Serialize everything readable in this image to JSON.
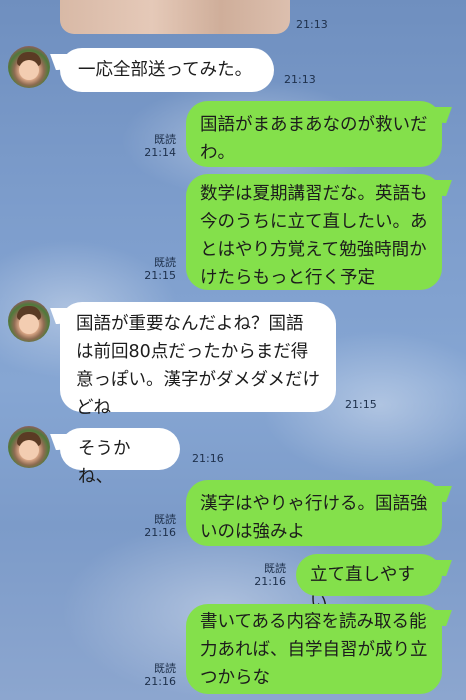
{
  "colors": {
    "background": "#7c9bc9",
    "sent_bubble": "#84e04b",
    "received_bubble": "#ffffff",
    "meta_text": "#1d2f4a"
  },
  "top_photo": {
    "time": "21:13"
  },
  "messages": [
    {
      "side": "left",
      "text": "一応全部送ってみた。",
      "time": "21:13"
    },
    {
      "side": "right",
      "text": "国語がまあまあなのが救いだわ。",
      "read": "既読",
      "time": "21:14"
    },
    {
      "side": "right",
      "text": "数学は夏期講習だな。英語も今のうちに立て直したい。あとはやり方覚えて勉強時間かけたらもっと行く予定",
      "read": "既読",
      "time": "21:15"
    },
    {
      "side": "left",
      "text": "国語が重要なんだよね？国語は前回80点だったからまだ得意っぽい。漢字がダメダメだけどね",
      "time": "21:15"
    },
    {
      "side": "left",
      "text": "そうかね、",
      "time": "21:16"
    },
    {
      "side": "right",
      "text": "漢字はやりゃ行ける。国語強いのは強みよ",
      "read": "既読",
      "time": "21:16"
    },
    {
      "side": "right",
      "text": "立て直しやすい",
      "read": "既読",
      "time": "21:16"
    },
    {
      "side": "right",
      "text": "書いてある内容を読み取る能力あれば、自学自習が成り立つからな",
      "read": "既読",
      "time": "21:16"
    }
  ]
}
